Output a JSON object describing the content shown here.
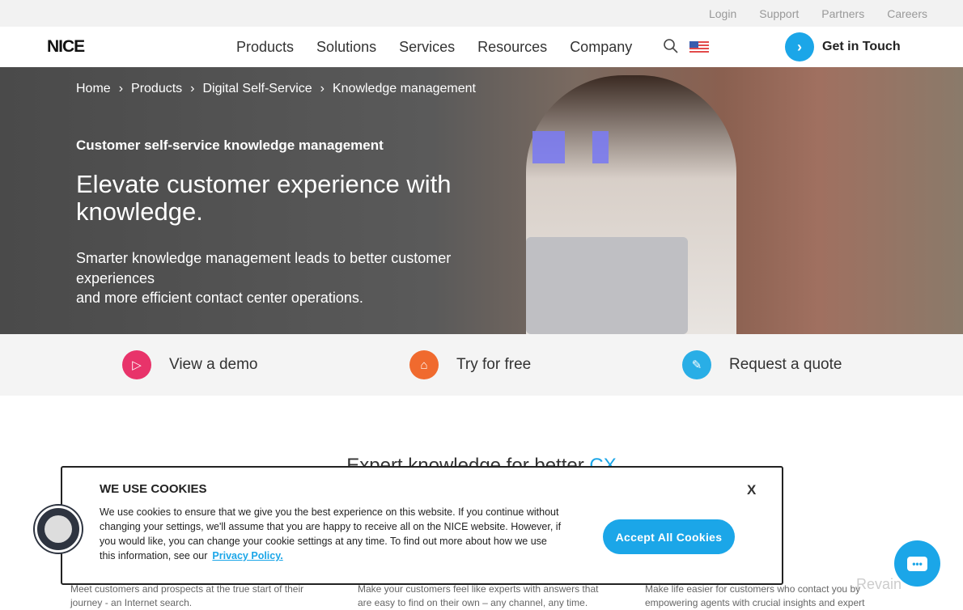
{
  "topbar": {
    "links": [
      "Login",
      "Support",
      "Partners",
      "Careers"
    ]
  },
  "nav": {
    "logo": "NICE",
    "items": [
      "Products",
      "Solutions",
      "Services",
      "Resources",
      "Company"
    ],
    "cta": "Get in Touch"
  },
  "hero": {
    "breadcrumb": [
      "Home",
      "Products",
      "Digital Self-Service",
      "Knowledge management"
    ],
    "eyebrow": "Customer self-service knowledge management",
    "title": "Elevate customer experience with knowledge.",
    "subtitle_1": "Smarter knowledge management leads to better customer experiences",
    "subtitle_2": "and more efficient contact center operations."
  },
  "ctas": [
    {
      "label": "View a demo",
      "icon": "play-icon",
      "color": "#e8336a"
    },
    {
      "label": "Try for free",
      "icon": "inbox-icon",
      "color": "#f06a2e"
    },
    {
      "label": "Request a quote",
      "icon": "pencil-icon",
      "color": "#29aee6"
    }
  ],
  "section": {
    "title_start": "Expert knowledge for better ",
    "title_accent": "CX"
  },
  "columns": [
    "Meet customers and prospects at the true start of their journey - an Internet search.",
    "Make your customers feel like experts with answers that are easy to find on their own – any channel, any time.",
    "Make life easier for customers who contact you by empowering agents with crucial insights and expert"
  ],
  "cookie": {
    "title": "WE USE COOKIES",
    "body": "We use cookies to ensure that we give you the best experience on this website. If you continue without changing your settings, we'll assume that you are happy to receive all on the NICE website. However, if you would like, you can change your cookie settings at any time. To find out more about how we use this information, see our",
    "link": "Privacy Policy.",
    "accept": "Accept All Cookies",
    "close": "X"
  },
  "watermark": "Revain",
  "colors": {
    "accent": "#1ba6e8"
  }
}
